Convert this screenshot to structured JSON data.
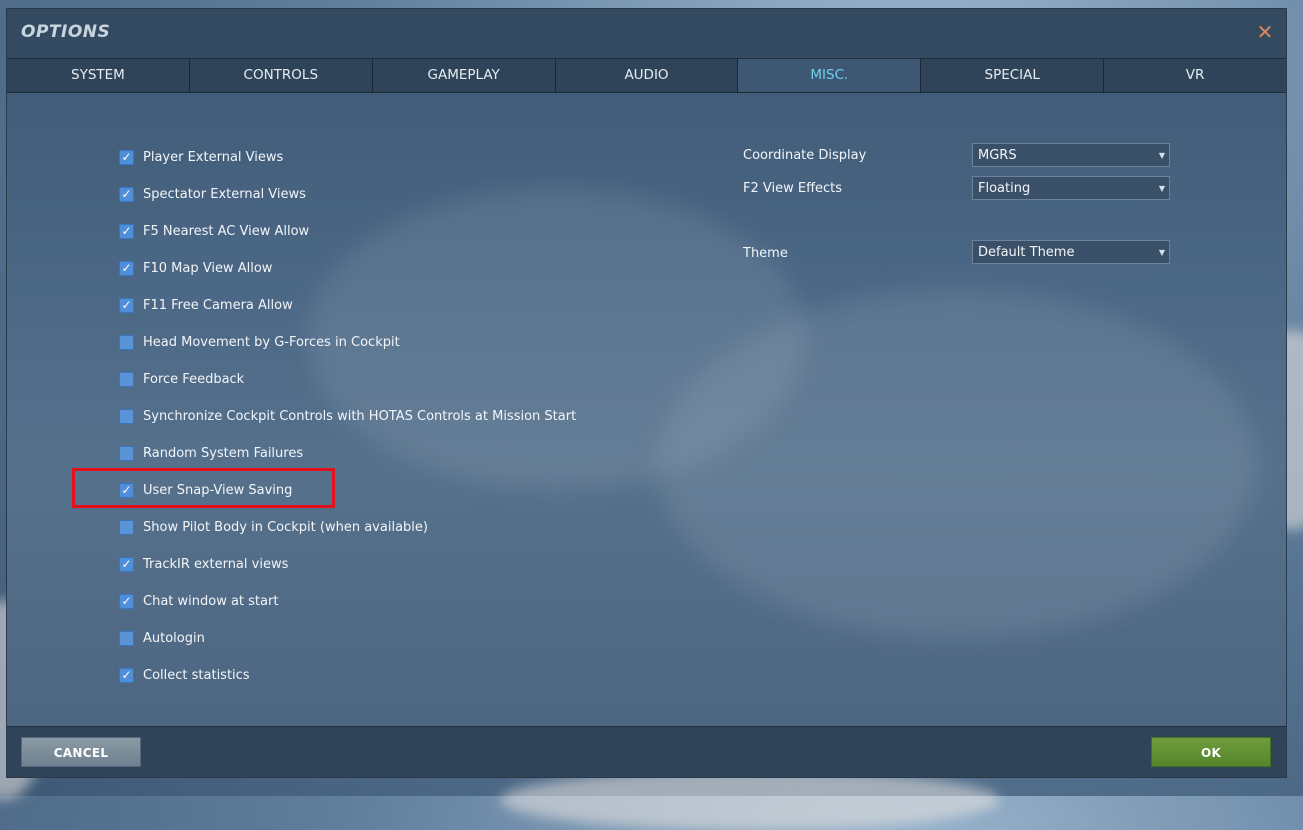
{
  "window": {
    "title": "OPTIONS"
  },
  "tabs": [
    {
      "label": "SYSTEM",
      "active": false
    },
    {
      "label": "CONTROLS",
      "active": false
    },
    {
      "label": "GAMEPLAY",
      "active": false
    },
    {
      "label": "AUDIO",
      "active": false
    },
    {
      "label": "MISC.",
      "active": true
    },
    {
      "label": "SPECIAL",
      "active": false
    },
    {
      "label": "VR",
      "active": false
    }
  ],
  "checkboxes": [
    {
      "label": "Player External Views",
      "checked": true
    },
    {
      "label": "Spectator External Views",
      "checked": true
    },
    {
      "label": "F5 Nearest AC View Allow",
      "checked": true
    },
    {
      "label": "F10 Map View Allow",
      "checked": true
    },
    {
      "label": "F11 Free Camera Allow",
      "checked": true
    },
    {
      "label": "Head Movement by G-Forces in Cockpit",
      "checked": false
    },
    {
      "label": "Force Feedback",
      "checked": false
    },
    {
      "label": "Synchronize Cockpit Controls with HOTAS Controls at Mission Start",
      "checked": false
    },
    {
      "label": "Random System Failures",
      "checked": false
    },
    {
      "label": "User Snap-View Saving",
      "checked": true
    },
    {
      "label": "Show Pilot Body in Cockpit (when available)",
      "checked": false
    },
    {
      "label": "TrackIR external views",
      "checked": true
    },
    {
      "label": "Chat window at start",
      "checked": true
    },
    {
      "label": "Autologin",
      "checked": false
    },
    {
      "label": "Collect statistics",
      "checked": true
    }
  ],
  "settings": {
    "coordinate_display": {
      "label": "Coordinate Display",
      "value": "MGRS"
    },
    "f2_view_effects": {
      "label": "F2 View Effects",
      "value": "Floating"
    },
    "theme": {
      "label": "Theme",
      "value": "Default Theme"
    }
  },
  "footer": {
    "cancel_label": "CANCEL",
    "ok_label": "OK"
  },
  "icons": {
    "close": "close-icon",
    "check": "check-icon",
    "dropdown": "chevron-down-icon"
  },
  "colors": {
    "active_tab": "#6fd0f0",
    "highlight": "#e3121a",
    "ok_button": "#5f8f30",
    "checkbox": "#4f8ed9"
  }
}
